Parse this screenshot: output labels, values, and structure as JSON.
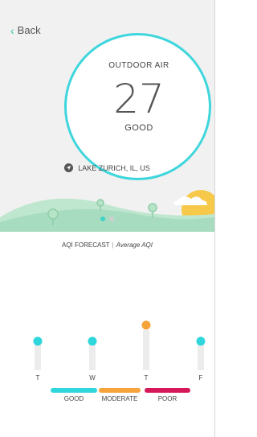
{
  "nav": {
    "back_label": "Back"
  },
  "summary": {
    "title": "OUTDOOR AIR",
    "aqi": "27",
    "status": "GOOD"
  },
  "location": {
    "text": "LAKE ZURICH, IL, US"
  },
  "pager": {
    "count": 2,
    "active": 0
  },
  "forecast": {
    "title": "AQI FORECAST",
    "subtitle": "Average AQI",
    "days": [
      "T",
      "W",
      "T",
      "F"
    ],
    "levels": [
      0.35,
      0.35,
      0.6,
      0.35
    ],
    "categories": [
      "good",
      "good",
      "moderate",
      "good"
    ]
  },
  "legend": [
    {
      "label": "GOOD",
      "color": "#2fd6dc"
    },
    {
      "label": "MODERATE",
      "color": "#f5a33a"
    },
    {
      "label": "POOR",
      "color": "#d6175a"
    }
  ],
  "colors": {
    "accent": "#31c2a8",
    "ring": "#3ed6dc",
    "good": "#2fd6dc",
    "moderate": "#f5a33a",
    "poor": "#d6175a"
  }
}
